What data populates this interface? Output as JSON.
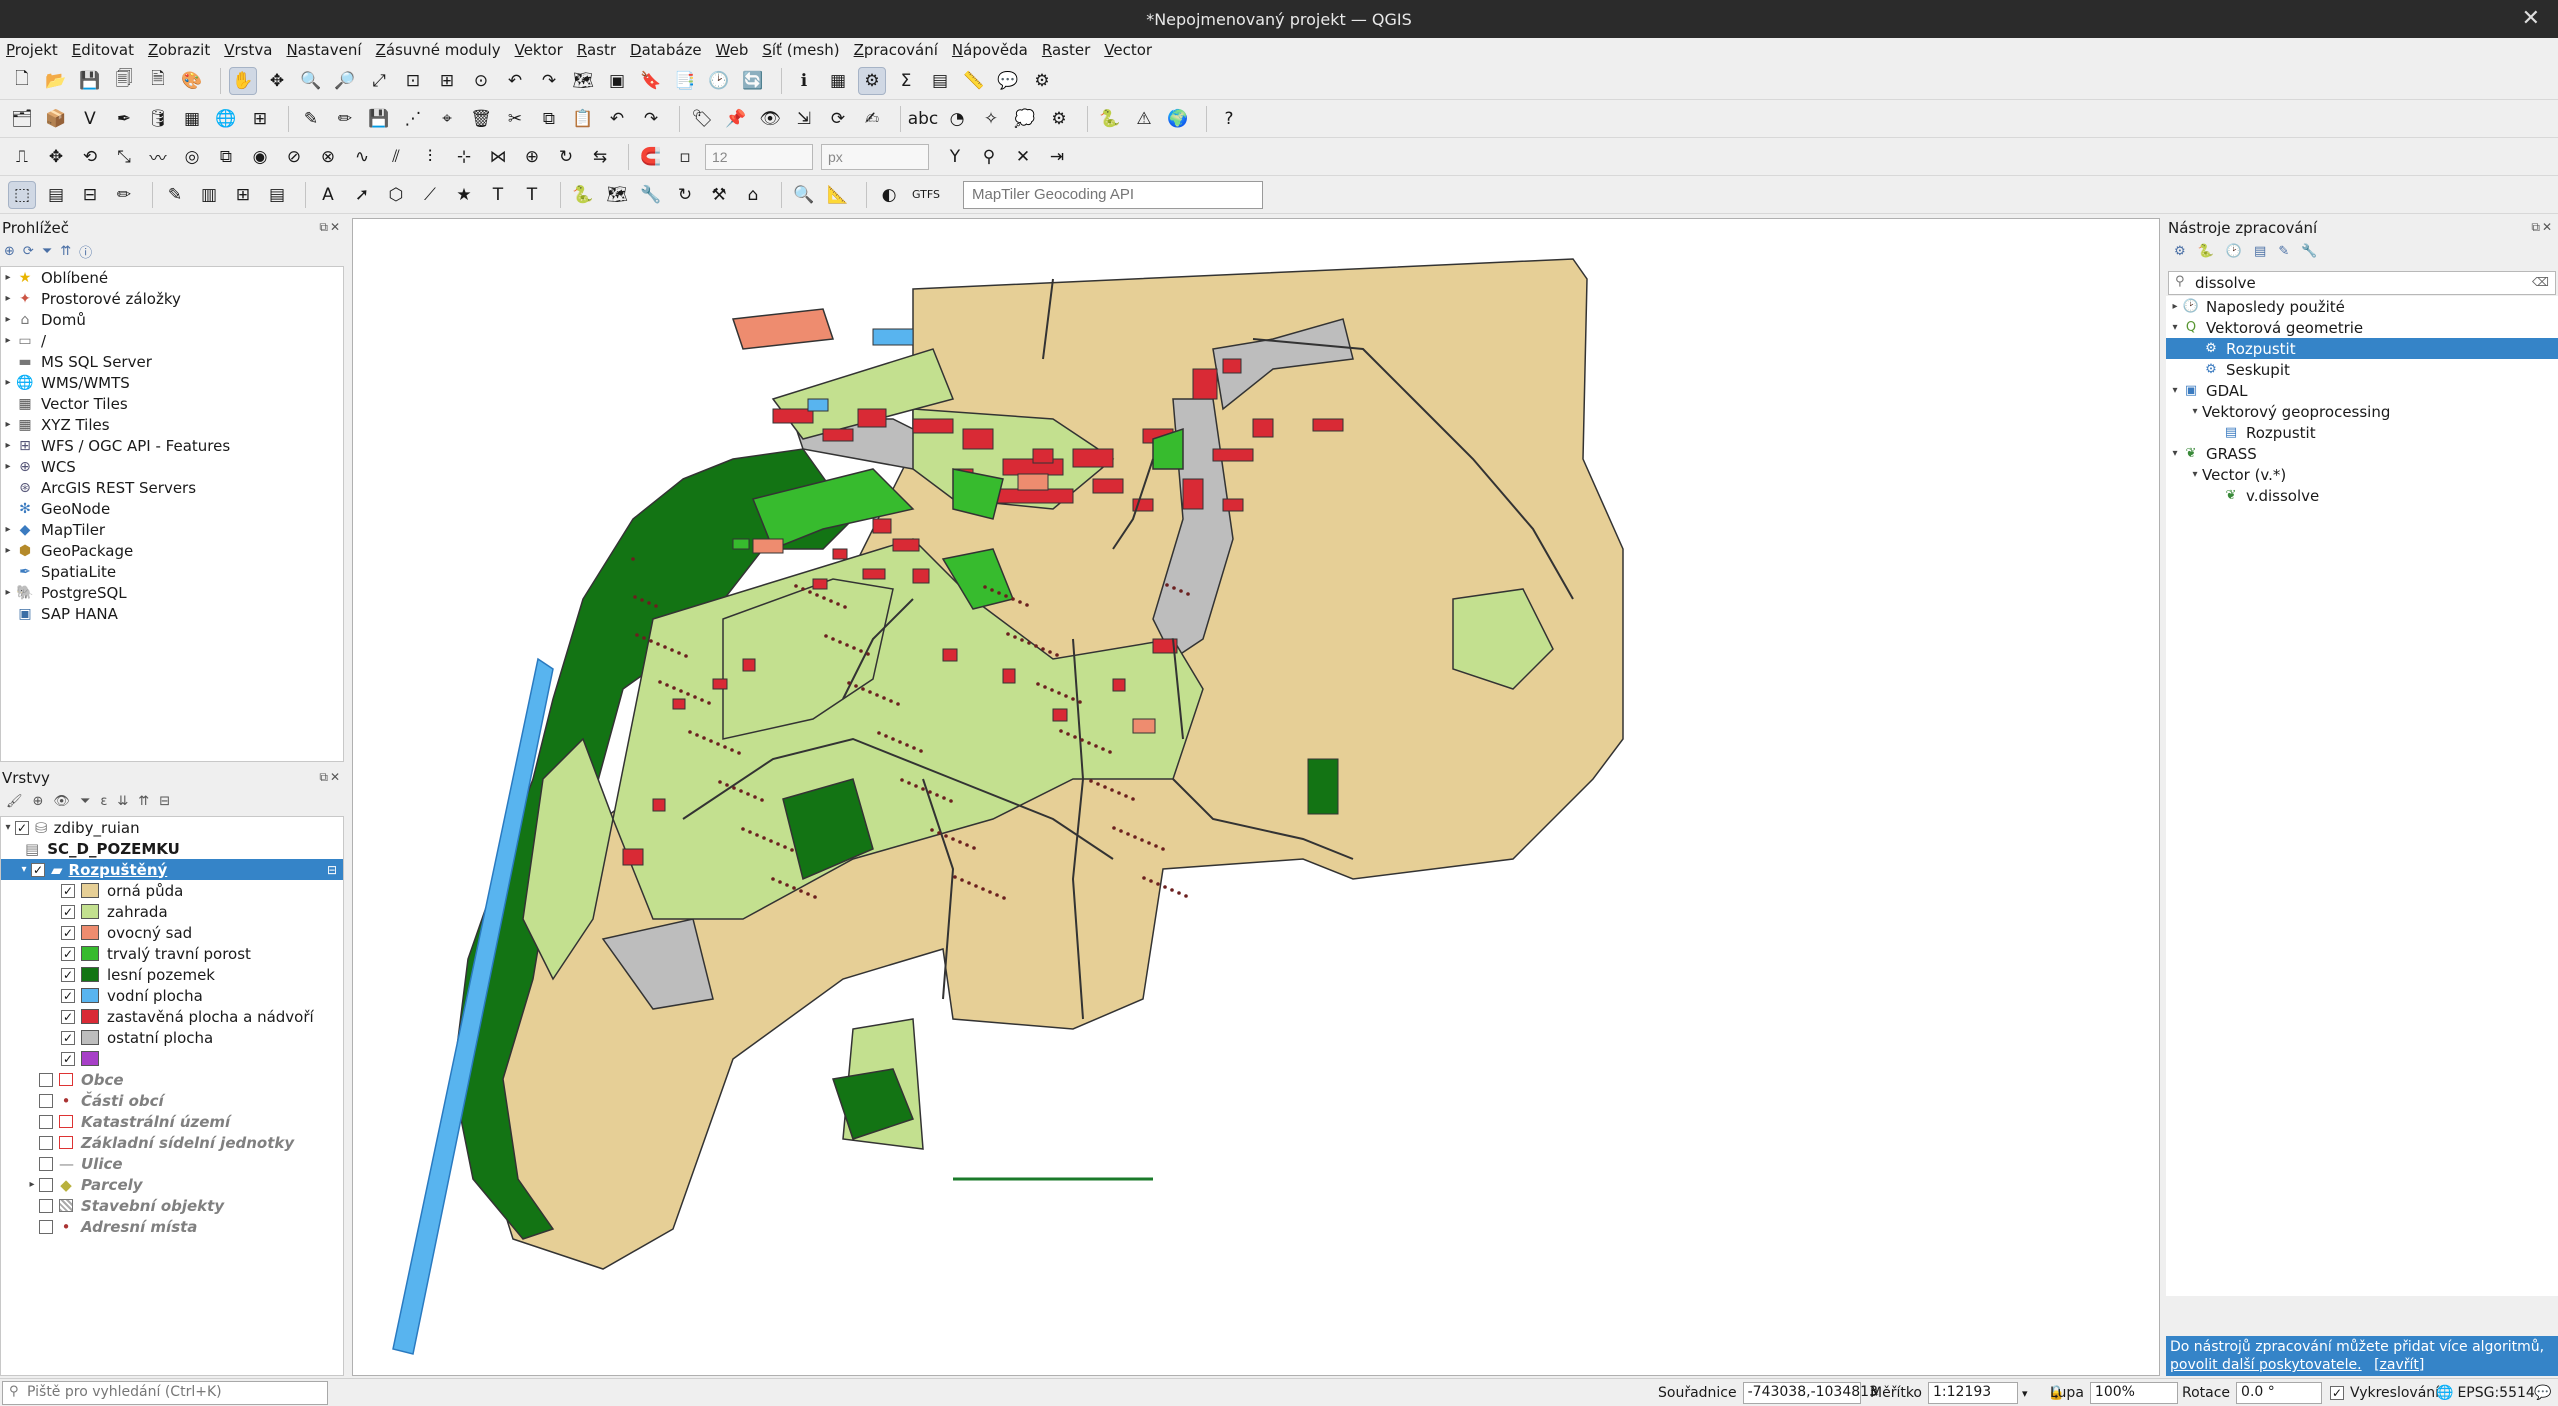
{
  "window": {
    "title": "*Nepojmenovaný projekt — QGIS"
  },
  "menu": [
    "Projekt",
    "Editovat",
    "Zobrazit",
    "Vrstva",
    "Nastavení",
    "Zásuvné moduly",
    "Vektor",
    "Rastr",
    "Databáze",
    "Web",
    "Síť (mesh)",
    "Zpracování",
    "Nápověda",
    "Raster",
    "Vector"
  ],
  "toolbar": {
    "snapping_tolerance": "12",
    "snapping_units": "px",
    "geocoder_placeholder": "MapTiler Geocoding API",
    "gtfs_label": "GTFS"
  },
  "browser": {
    "title": "Prohlížeč",
    "items": [
      {
        "label": "Oblíbené",
        "icon": "star-icon"
      },
      {
        "label": "Prostorové záložky",
        "icon": "bookmark-icon"
      },
      {
        "label": "Domů",
        "icon": "home-folder-icon"
      },
      {
        "label": "/",
        "icon": "folder-icon"
      },
      {
        "label": "MS SQL Server",
        "icon": "mssql-icon"
      },
      {
        "label": "WMS/WMTS",
        "icon": "wms-icon"
      },
      {
        "label": "Vector Tiles",
        "icon": "vector-tiles-icon"
      },
      {
        "label": "XYZ Tiles",
        "icon": "xyz-tiles-icon"
      },
      {
        "label": "WFS / OGC API - Features",
        "icon": "wfs-icon"
      },
      {
        "label": "WCS",
        "icon": "wcs-icon"
      },
      {
        "label": "ArcGIS REST Servers",
        "icon": "arcgis-icon"
      },
      {
        "label": "GeoNode",
        "icon": "geonode-icon"
      },
      {
        "label": "MapTiler",
        "icon": "maptiler-icon"
      },
      {
        "label": "GeoPackage",
        "icon": "geopackage-icon"
      },
      {
        "label": "SpatiaLite",
        "icon": "spatialite-icon"
      },
      {
        "label": "PostgreSQL",
        "icon": "postgresql-icon"
      },
      {
        "label": "SAP HANA",
        "icon": "saphana-icon"
      }
    ]
  },
  "layers": {
    "title": "Vrstvy",
    "group": "zdiby_ruian",
    "sublayer": "SC_D_POZEMKU",
    "selected_layer": "Rozpuštěný",
    "legend": [
      {
        "label": "orná půda",
        "color": "#e6cf96"
      },
      {
        "label": "zahrada",
        "color": "#c3e08f"
      },
      {
        "label": "ovocný sad",
        "color": "#ee8c6f"
      },
      {
        "label": "trvalý travní porost",
        "color": "#37bb2e"
      },
      {
        "label": "lesní pozemek",
        "color": "#137414"
      },
      {
        "label": "vodní plocha",
        "color": "#58b4ef"
      },
      {
        "label": "zastavěná plocha a nádvoří",
        "color": "#d92a35"
      },
      {
        "label": "ostatní plocha",
        "color": "#bdbdbd"
      },
      {
        "label": "",
        "color": "#a73fc7"
      }
    ],
    "others": [
      {
        "label": "Obce",
        "icon": "polygon-outline-icon"
      },
      {
        "label": "Části obcí",
        "icon": "point-icon"
      },
      {
        "label": "Katastrální území",
        "icon": "polygon-outline-icon"
      },
      {
        "label": "Základní sídelní jednotky",
        "icon": "polygon-outline-icon"
      },
      {
        "label": "Ulice",
        "icon": "line-icon"
      },
      {
        "label": "Parcely",
        "icon": "polygon-fill-icon"
      },
      {
        "label": "Stavební objekty",
        "icon": "hatched-polygon-icon"
      },
      {
        "label": "Adresní místa",
        "icon": "point-icon"
      }
    ]
  },
  "processing": {
    "title": "Nástroje zpracování",
    "search_value": "dissolve",
    "tree": [
      {
        "label": "Naposledy použité",
        "level": 0,
        "icon": "clock-icon"
      },
      {
        "label": "Vektorová geometrie",
        "level": 0,
        "icon": "qgis-icon"
      },
      {
        "label": "Rozpustit",
        "level": 1,
        "icon": "algorithm-icon",
        "selected": true
      },
      {
        "label": "Seskupit",
        "level": 1,
        "icon": "algorithm-icon"
      },
      {
        "label": "GDAL",
        "level": 0,
        "icon": "gdal-icon"
      },
      {
        "label": "Vektorový geoprocessing",
        "level": 1,
        "icon": ""
      },
      {
        "label": "Rozpustit",
        "level": 2,
        "icon": "gdal-algorithm-icon"
      },
      {
        "label": "GRASS",
        "level": 0,
        "icon": "grass-icon"
      },
      {
        "label": "Vector (v.*)",
        "level": 1,
        "icon": ""
      },
      {
        "label": "v.dissolve",
        "level": 2,
        "icon": "grass-algorithm-icon"
      }
    ],
    "info_text": "Do nástrojů zpracování můžete přidat více algoritmů,",
    "info_link": "povolit další poskytovatele.",
    "info_close": "[zavřít]"
  },
  "status": {
    "locator_placeholder": "Piště pro vyhledání (Ctrl+K)",
    "coord_label": "Souřadnice",
    "coord_value": "-743038,-1034813",
    "scale_label": "Měřítko",
    "scale_value": "1:12193",
    "magnifier_label": "Lupa",
    "magnifier_value": "100%",
    "rotation_label": "Rotace",
    "rotation_value": "0.0 °",
    "render_label": "Vykreslování",
    "crs": "EPSG:5514"
  },
  "map_colors": {
    "arable": "#e6cf96",
    "garden": "#c3e08f",
    "orchard": "#ee8c6f",
    "grass": "#37bb2e",
    "forest": "#137414",
    "water": "#58b4ef",
    "built": "#d92a35",
    "other": "#bdbdbd"
  }
}
